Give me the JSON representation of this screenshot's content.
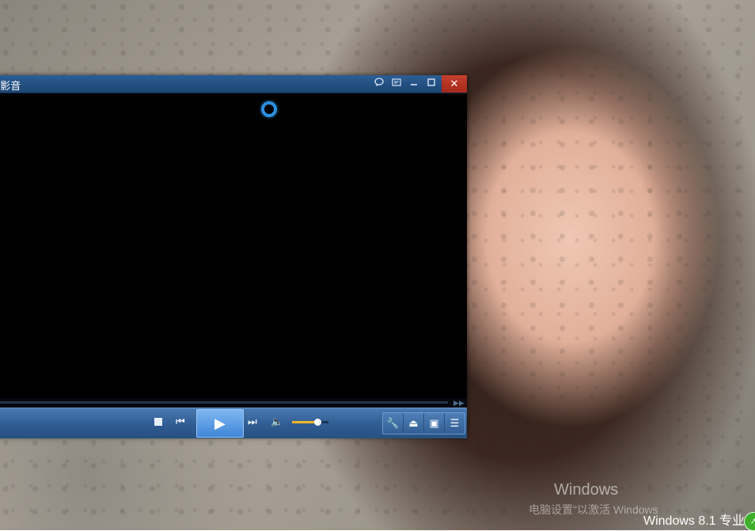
{
  "player": {
    "title": "Q影音",
    "titlebar_buttons": [
      {
        "name": "chat",
        "icon": "speech-bubble-icon"
      },
      {
        "name": "menu",
        "icon": "window-menu-icon"
      },
      {
        "name": "minimize",
        "icon": "minimize-icon"
      },
      {
        "name": "maximize",
        "icon": "maximize-icon"
      },
      {
        "name": "close",
        "icon": "close-icon",
        "label": "✕"
      }
    ],
    "loading": true,
    "seek_progress": 0,
    "controls": {
      "stop": "stop-icon",
      "prev": "previous-icon",
      "play": "play-icon",
      "next": "next-icon",
      "volume": "volume-icon",
      "volume_level": 0.7
    },
    "tools": [
      "wrench-icon",
      "eject-icon",
      "screen-icon",
      "playlist-icon"
    ],
    "accent_color": "#3d8fe0",
    "volume_color": "#f0b528",
    "close_color": "#c6402b"
  },
  "desktop": {
    "watermark_title": "Windows",
    "watermark_sub": "电脑设置\"以激活 Windows",
    "edition": "Windows 8.1 专业"
  }
}
